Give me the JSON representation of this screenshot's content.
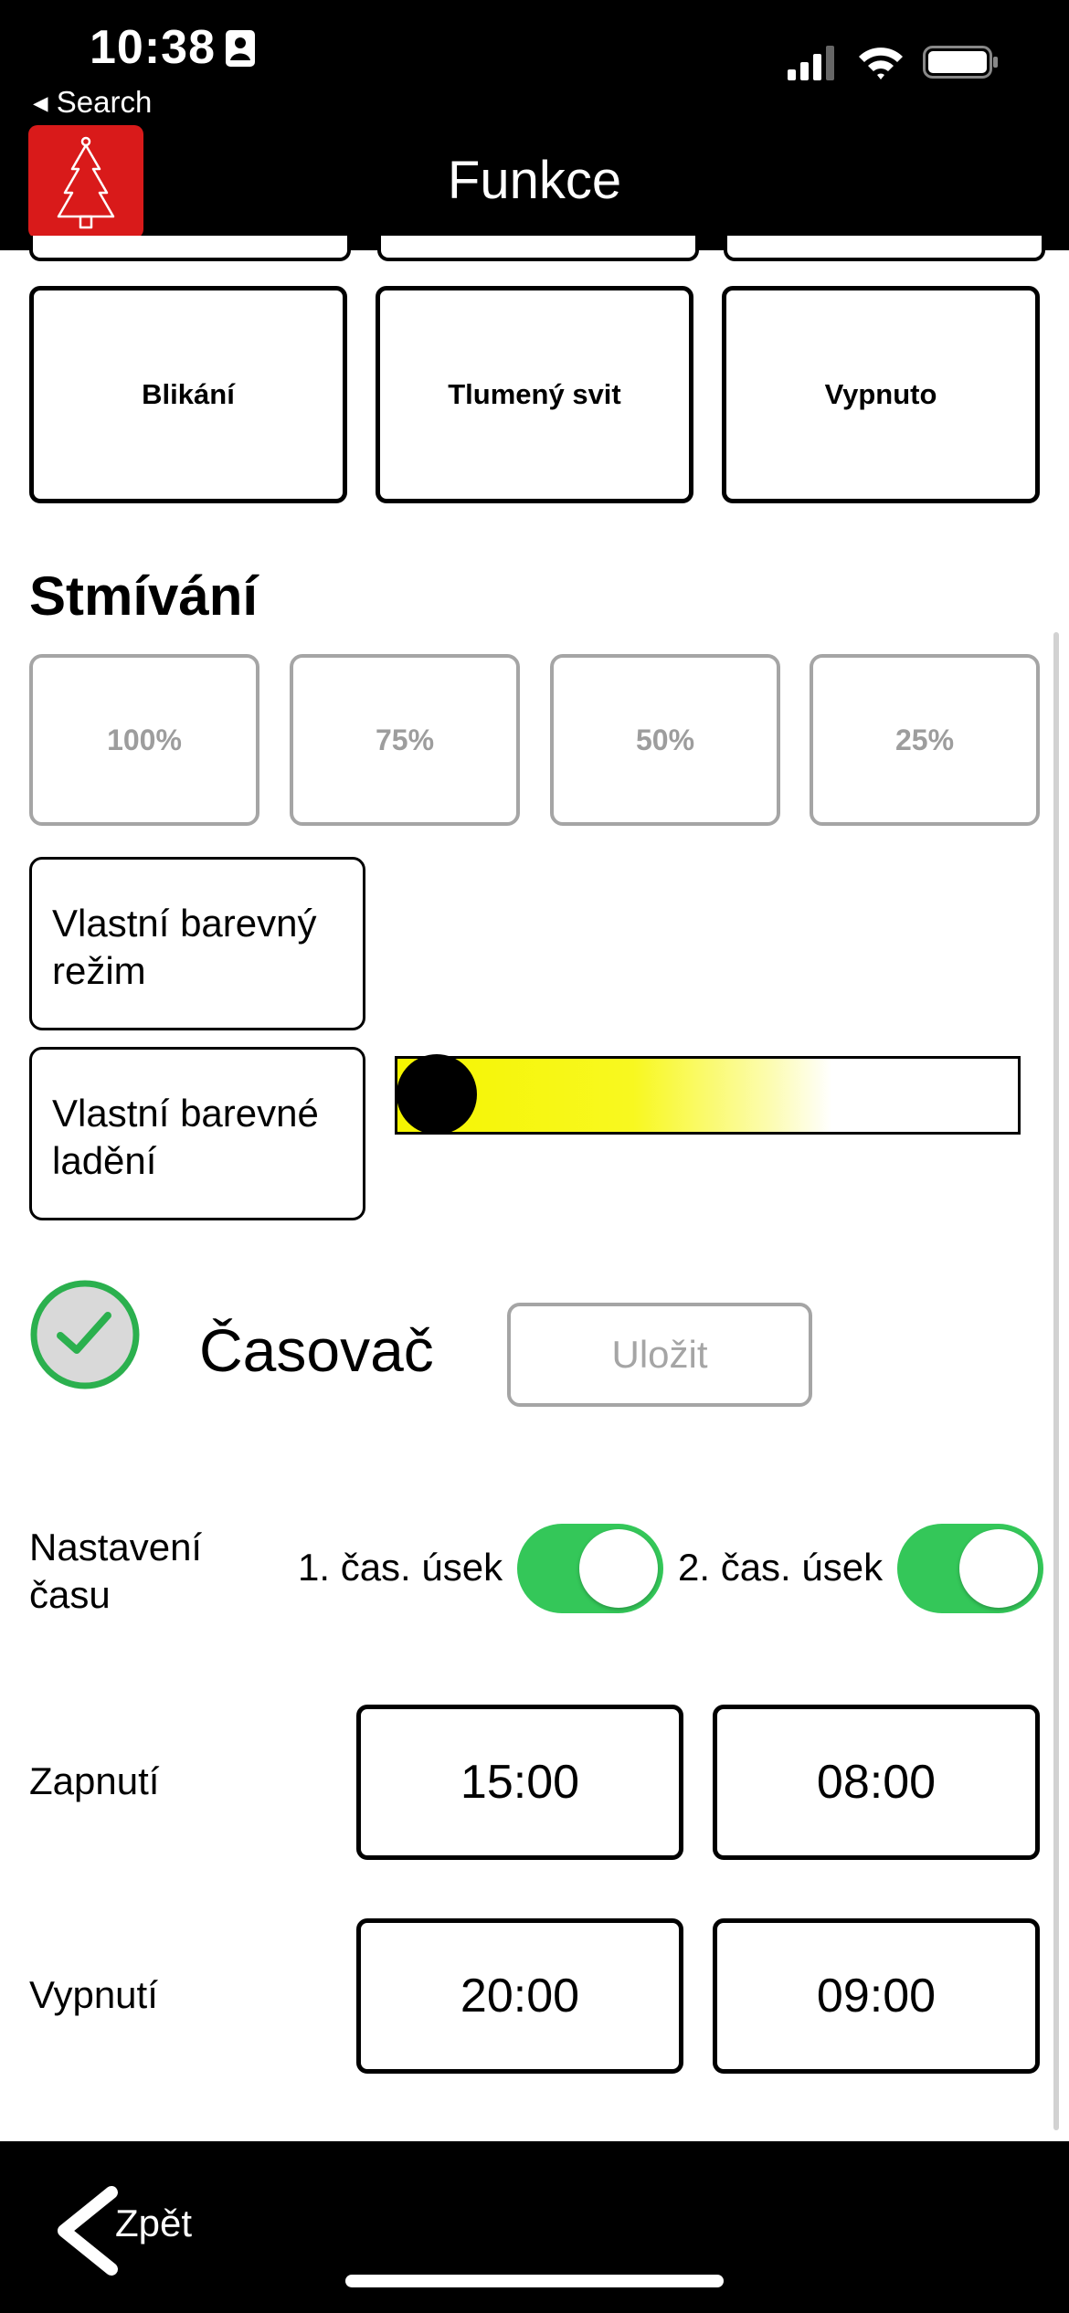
{
  "status_bar": {
    "time": "10:38",
    "back_link": "◂ Search"
  },
  "header": {
    "title": "Funkce"
  },
  "modes": [
    "Blikání",
    "Tlumený svit",
    "Vypnuto"
  ],
  "dimming": {
    "title": "Stmívání",
    "levels": [
      "100%",
      "75%",
      "50%",
      "25%"
    ]
  },
  "custom": {
    "color_mode": "Vlastní barevný režim",
    "color_tuning": "Vlastní barevné ladění",
    "slider_value_percent": 7
  },
  "timer": {
    "label": "Časovač",
    "enabled": true,
    "save_label": "Uložit",
    "time_setting_label": "Nastavení času",
    "slot1_label": "1. čas. úsek",
    "slot2_label": "2. čas. úsek",
    "slot1_enabled": true,
    "slot2_enabled": true,
    "on_label": "Zapnutí",
    "off_label": "Vypnutí",
    "on_times": [
      "15:00",
      "08:00"
    ],
    "off_times": [
      "20:00",
      "09:00"
    ]
  },
  "bottom": {
    "back_label": "Zpět"
  },
  "colors": {
    "accent_green": "#34c759",
    "app_red": "#d91a1a",
    "dim_gray": "#a5a5a5"
  },
  "icons": [
    "id-card-icon",
    "signal-icon",
    "wifi-icon",
    "battery-icon",
    "tree-icon",
    "check-circle-icon",
    "chevron-left-icon"
  ]
}
